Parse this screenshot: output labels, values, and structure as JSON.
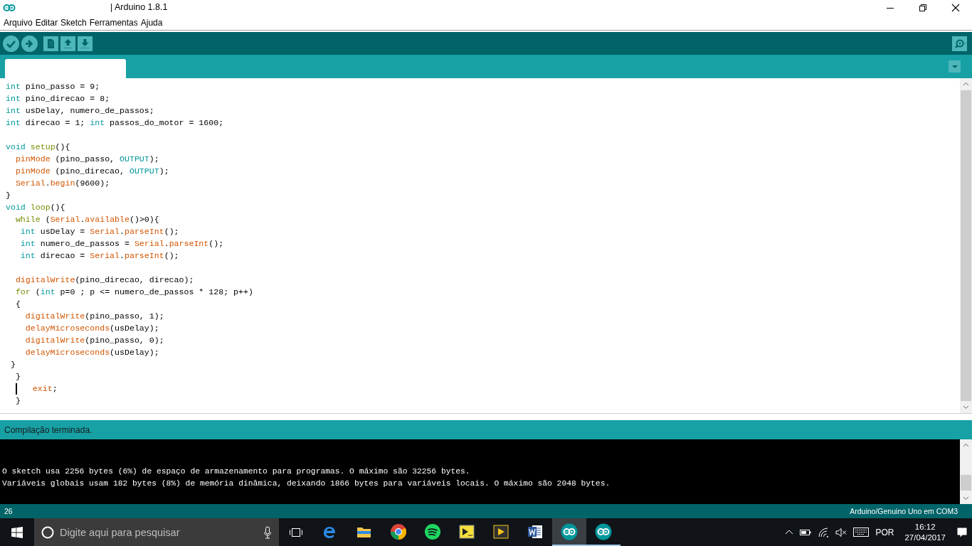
{
  "window": {
    "title": "| Arduino 1.8.1"
  },
  "menu": [
    "Arquivo",
    "Editar",
    "Sketch",
    "Ferramentas",
    "Ajuda"
  ],
  "toolbar": {
    "buttons": [
      {
        "kind": "verify"
      },
      {
        "kind": "upload"
      },
      {
        "kind": "new"
      },
      {
        "kind": "open"
      },
      {
        "kind": "save"
      }
    ]
  },
  "editor": {
    "lines": [
      {
        "kind": "code",
        "tokens": [
          {
            "kind": "type",
            "text": "int"
          },
          {
            "kind": "plain",
            "text": " pino_passo = 9;"
          }
        ]
      },
      {
        "kind": "code",
        "tokens": [
          {
            "kind": "type",
            "text": "int"
          },
          {
            "kind": "plain",
            "text": " pino_direcao = 8;"
          }
        ]
      },
      {
        "kind": "code",
        "tokens": [
          {
            "kind": "type",
            "text": "int"
          },
          {
            "kind": "plain",
            "text": " usDelay, numero_de_passos;"
          }
        ]
      },
      {
        "kind": "code",
        "tokens": [
          {
            "kind": "type",
            "text": "int"
          },
          {
            "kind": "plain",
            "text": " direcao = 1; "
          },
          {
            "kind": "type",
            "text": "int"
          },
          {
            "kind": "plain",
            "text": " passos_do_motor = 1600;"
          }
        ]
      },
      {
        "kind": "blank"
      },
      {
        "kind": "code",
        "tokens": [
          {
            "kind": "type",
            "text": "void"
          },
          {
            "kind": "control",
            "text": " setup"
          },
          {
            "kind": "plain",
            "text": "(){"
          }
        ]
      },
      {
        "kind": "code",
        "tokens": [
          {
            "kind": "func",
            "text": "  pinMode"
          },
          {
            "kind": "plain",
            "text": " (pino_passo, "
          },
          {
            "kind": "const",
            "text": "OUTPUT"
          },
          {
            "kind": "plain",
            "text": ");"
          }
        ]
      },
      {
        "kind": "code",
        "tokens": [
          {
            "kind": "func",
            "text": "  pinMode"
          },
          {
            "kind": "plain",
            "text": " (pino_direcao, "
          },
          {
            "kind": "const",
            "text": "OUTPUT"
          },
          {
            "kind": "plain",
            "text": ");"
          }
        ]
      },
      {
        "kind": "code",
        "tokens": [
          {
            "kind": "func",
            "text": "  Serial"
          },
          {
            "kind": "plain",
            "text": "."
          },
          {
            "kind": "func",
            "text": "begin"
          },
          {
            "kind": "plain",
            "text": "(9600);"
          }
        ]
      },
      {
        "kind": "code",
        "tokens": [
          {
            "kind": "plain",
            "text": "}"
          }
        ]
      },
      {
        "kind": "code",
        "tokens": [
          {
            "kind": "type",
            "text": "void"
          },
          {
            "kind": "control",
            "text": " loop"
          },
          {
            "kind": "plain",
            "text": "(){"
          }
        ]
      },
      {
        "kind": "code",
        "tokens": [
          {
            "kind": "control",
            "text": "  while"
          },
          {
            "kind": "plain",
            "text": " ("
          },
          {
            "kind": "func",
            "text": "Serial"
          },
          {
            "kind": "plain",
            "text": "."
          },
          {
            "kind": "func",
            "text": "available"
          },
          {
            "kind": "plain",
            "text": "()>0){"
          }
        ]
      },
      {
        "kind": "code",
        "tokens": [
          {
            "kind": "type",
            "text": "   int"
          },
          {
            "kind": "plain",
            "text": " usDelay = "
          },
          {
            "kind": "func",
            "text": "Serial"
          },
          {
            "kind": "plain",
            "text": "."
          },
          {
            "kind": "func",
            "text": "parseInt"
          },
          {
            "kind": "plain",
            "text": "();"
          }
        ]
      },
      {
        "kind": "code",
        "tokens": [
          {
            "kind": "type",
            "text": "   int"
          },
          {
            "kind": "plain",
            "text": " numero_de_passos = "
          },
          {
            "kind": "func",
            "text": "Serial"
          },
          {
            "kind": "plain",
            "text": "."
          },
          {
            "kind": "func",
            "text": "parseInt"
          },
          {
            "kind": "plain",
            "text": "();"
          }
        ]
      },
      {
        "kind": "code",
        "tokens": [
          {
            "kind": "type",
            "text": "   int"
          },
          {
            "kind": "plain",
            "text": " direcao = "
          },
          {
            "kind": "func",
            "text": "Serial"
          },
          {
            "kind": "plain",
            "text": "."
          },
          {
            "kind": "func",
            "text": "parseInt"
          },
          {
            "kind": "plain",
            "text": "();"
          }
        ]
      },
      {
        "kind": "blank"
      },
      {
        "kind": "code",
        "tokens": [
          {
            "kind": "func",
            "text": "  digitalWrite"
          },
          {
            "kind": "plain",
            "text": "(pino_direcao, direcao);"
          }
        ]
      },
      {
        "kind": "code",
        "tokens": [
          {
            "kind": "control",
            "text": "  for"
          },
          {
            "kind": "plain",
            "text": " ("
          },
          {
            "kind": "type",
            "text": "int"
          },
          {
            "kind": "plain",
            "text": " p=0 ; p <= numero_de_passos * 128; p++)"
          }
        ]
      },
      {
        "kind": "code",
        "tokens": [
          {
            "kind": "plain",
            "text": "  {"
          }
        ]
      },
      {
        "kind": "code",
        "tokens": [
          {
            "kind": "func",
            "text": "    digitalWrite"
          },
          {
            "kind": "plain",
            "text": "(pino_passo, 1);"
          }
        ]
      },
      {
        "kind": "code",
        "tokens": [
          {
            "kind": "func",
            "text": "    delayMicroseconds"
          },
          {
            "kind": "plain",
            "text": "(usDelay);"
          }
        ]
      },
      {
        "kind": "code",
        "tokens": [
          {
            "kind": "func",
            "text": "    digitalWrite"
          },
          {
            "kind": "plain",
            "text": "(pino_passo, 0);"
          }
        ]
      },
      {
        "kind": "code",
        "tokens": [
          {
            "kind": "func",
            "text": "    delayMicroseconds"
          },
          {
            "kind": "plain",
            "text": "(usDelay);"
          }
        ]
      },
      {
        "kind": "code",
        "tokens": [
          {
            "kind": "plain",
            "text": " }"
          }
        ]
      },
      {
        "kind": "code",
        "tokens": [
          {
            "kind": "plain",
            "text": "  }"
          }
        ]
      },
      {
        "kind": "code",
        "tokens": [
          {
            "kind": "caret"
          },
          {
            "kind": "func",
            "text": "   exit"
          },
          {
            "kind": "plain",
            "text": ";"
          }
        ]
      },
      {
        "kind": "code",
        "tokens": [
          {
            "kind": "plain",
            "text": "  }"
          }
        ]
      }
    ]
  },
  "message": "Compilação terminada.",
  "console": {
    "lines": [
      "O sketch usa 2256 bytes (6%) de espaço de armazenamento para programas. O máximo são 32256 bytes.",
      "Variáveis globais usam 182 bytes (8%) de memória dinâmica, deixando 1866 bytes para variáveis locais. O máximo são 2048 bytes."
    ]
  },
  "status_bar": {
    "line": "26",
    "board": "Arduino/Genuino Uno em COM3"
  },
  "taskbar": {
    "search": {
      "placeholder": "Digite aqui para pesquisar"
    },
    "apps": [
      {
        "kind": "edge",
        "selected": false
      },
      {
        "kind": "folder",
        "selected": false
      },
      {
        "kind": "chrome",
        "selected": false
      },
      {
        "kind": "spotify",
        "selected": false
      },
      {
        "kind": "labview",
        "selected": false
      },
      {
        "kind": "video",
        "selected": false
      },
      {
        "kind": "word",
        "selected": false
      },
      {
        "kind": "arduino",
        "selected": true
      },
      {
        "kind": "arduino",
        "selected": false
      }
    ],
    "language": "POR",
    "time": "16:12",
    "date": "27/04/2017"
  }
}
